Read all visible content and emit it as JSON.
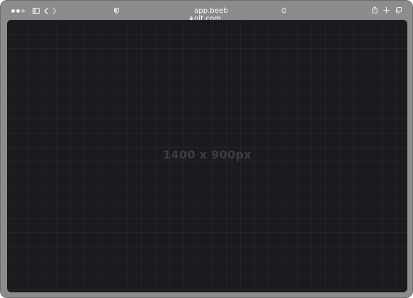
{
  "browser": {
    "url": "app.beebolt.com",
    "controls": {
      "traffic_lights": [
        "close",
        "minimize",
        "zoom"
      ],
      "sidebar_icon": "sidebar-icon",
      "back_icon": "chevron-left-icon",
      "forward_icon": "chevron-right-icon",
      "privacy_icon": "shield-icon",
      "lock_icon": "lock-icon",
      "reload_icon": "reload-icon",
      "share_icon": "share-icon",
      "new_tab_icon": "plus-icon",
      "tabs_icon": "tabs-overview-icon"
    }
  },
  "viewport": {
    "placeholder_label": "1400 x 900px"
  },
  "colors": {
    "frame": "#8c8c8c",
    "viewport_bg": "#1b1b1f",
    "placeholder_text": "#3c3c42",
    "toolbar_icons": "#f4f4f4"
  }
}
